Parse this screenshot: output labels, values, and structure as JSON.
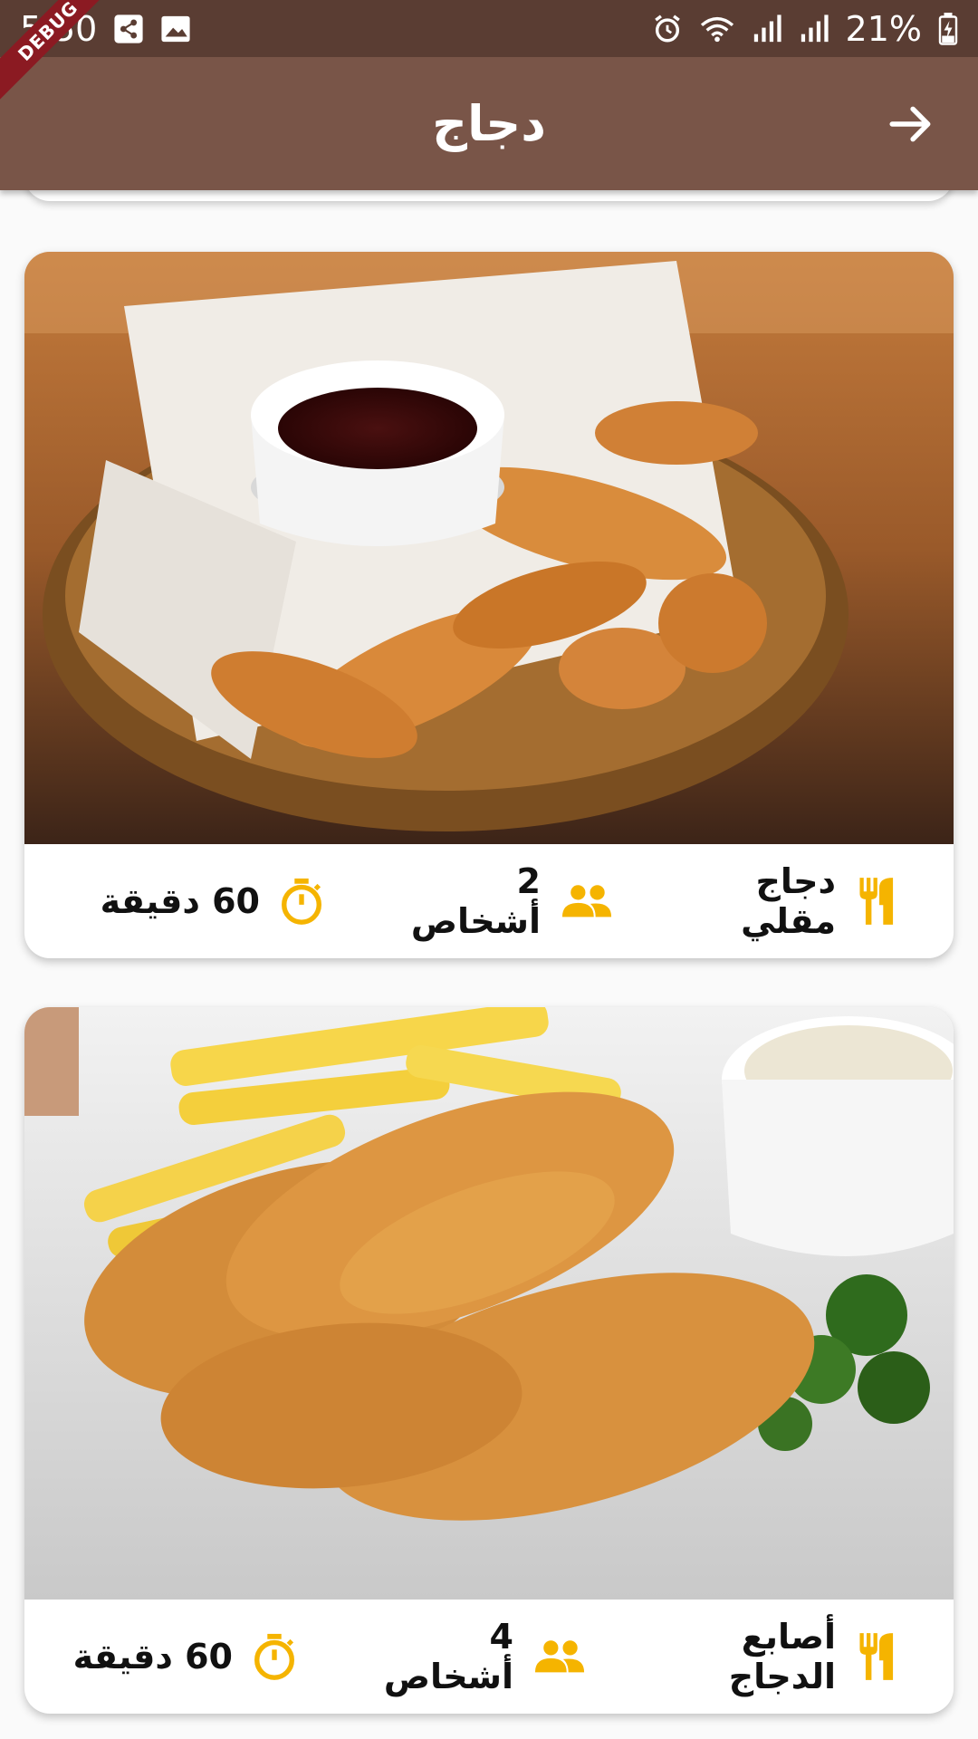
{
  "status_bar": {
    "time": "5:50",
    "battery": "21%",
    "icons": [
      "share-icon",
      "image-icon",
      "alarm-icon",
      "wifi-icon",
      "signal-icon",
      "signal-icon",
      "battery-icon"
    ]
  },
  "debug_label": "DEBUG",
  "app_bar": {
    "title": "دجاج",
    "back_icon": "arrow-right-icon"
  },
  "colors": {
    "status_bar": "#5a3d33",
    "app_bar": "#795548",
    "accent": "#f5b400",
    "background": "#fafafa"
  },
  "recipes": [
    {
      "name": "دجاج مقلي",
      "servings": "2 أشخاص",
      "time": "60 دقيقة",
      "image": "chicken-nuggets-basket"
    },
    {
      "name": "أصابع الدجاج",
      "servings": "4 أشخاص",
      "time": "60 دقيقة",
      "image": "chicken-fingers-with-fries"
    }
  ]
}
